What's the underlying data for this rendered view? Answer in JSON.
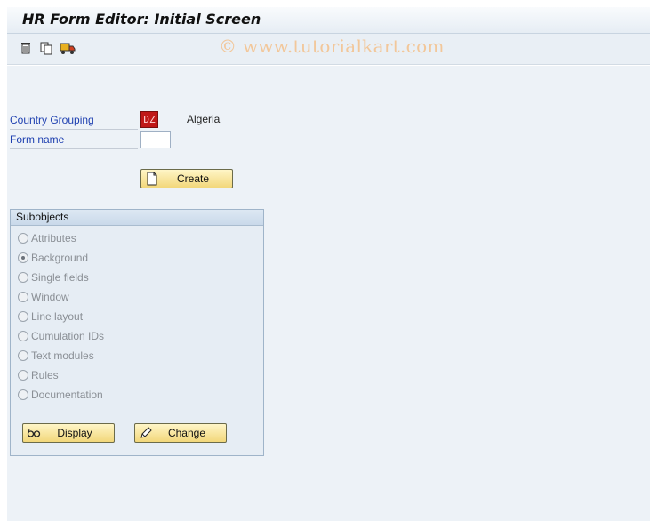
{
  "window": {
    "title": "HR Form Editor: Initial Screen"
  },
  "toolbar": {
    "icons": [
      "delete-icon",
      "copy-icon",
      "transport-icon"
    ],
    "watermark": "© www.tutorialkart.com"
  },
  "fields": {
    "country_grouping": {
      "label": "Country Grouping",
      "value": "DZ",
      "description": "Algeria"
    },
    "form_name": {
      "label": "Form name",
      "value": ""
    }
  },
  "create_button": {
    "label": "Create",
    "icon": "new-document-icon"
  },
  "subobjects": {
    "title": "Subobjects",
    "selected": "Background",
    "options": [
      {
        "label": "Attributes"
      },
      {
        "label": "Background"
      },
      {
        "label": "Single fields"
      },
      {
        "label": "Window"
      },
      {
        "label": "Line layout"
      },
      {
        "label": "Cumulation IDs"
      },
      {
        "label": "Text modules"
      },
      {
        "label": "Rules"
      },
      {
        "label": "Documentation"
      }
    ],
    "display_button": {
      "label": "Display",
      "icon": "glasses-icon"
    },
    "change_button": {
      "label": "Change",
      "icon": "pencil-icon"
    }
  },
  "colors": {
    "label_blue": "#1d3fb0",
    "button_yellow": "#f2d77a",
    "dz_red": "#c01818"
  }
}
